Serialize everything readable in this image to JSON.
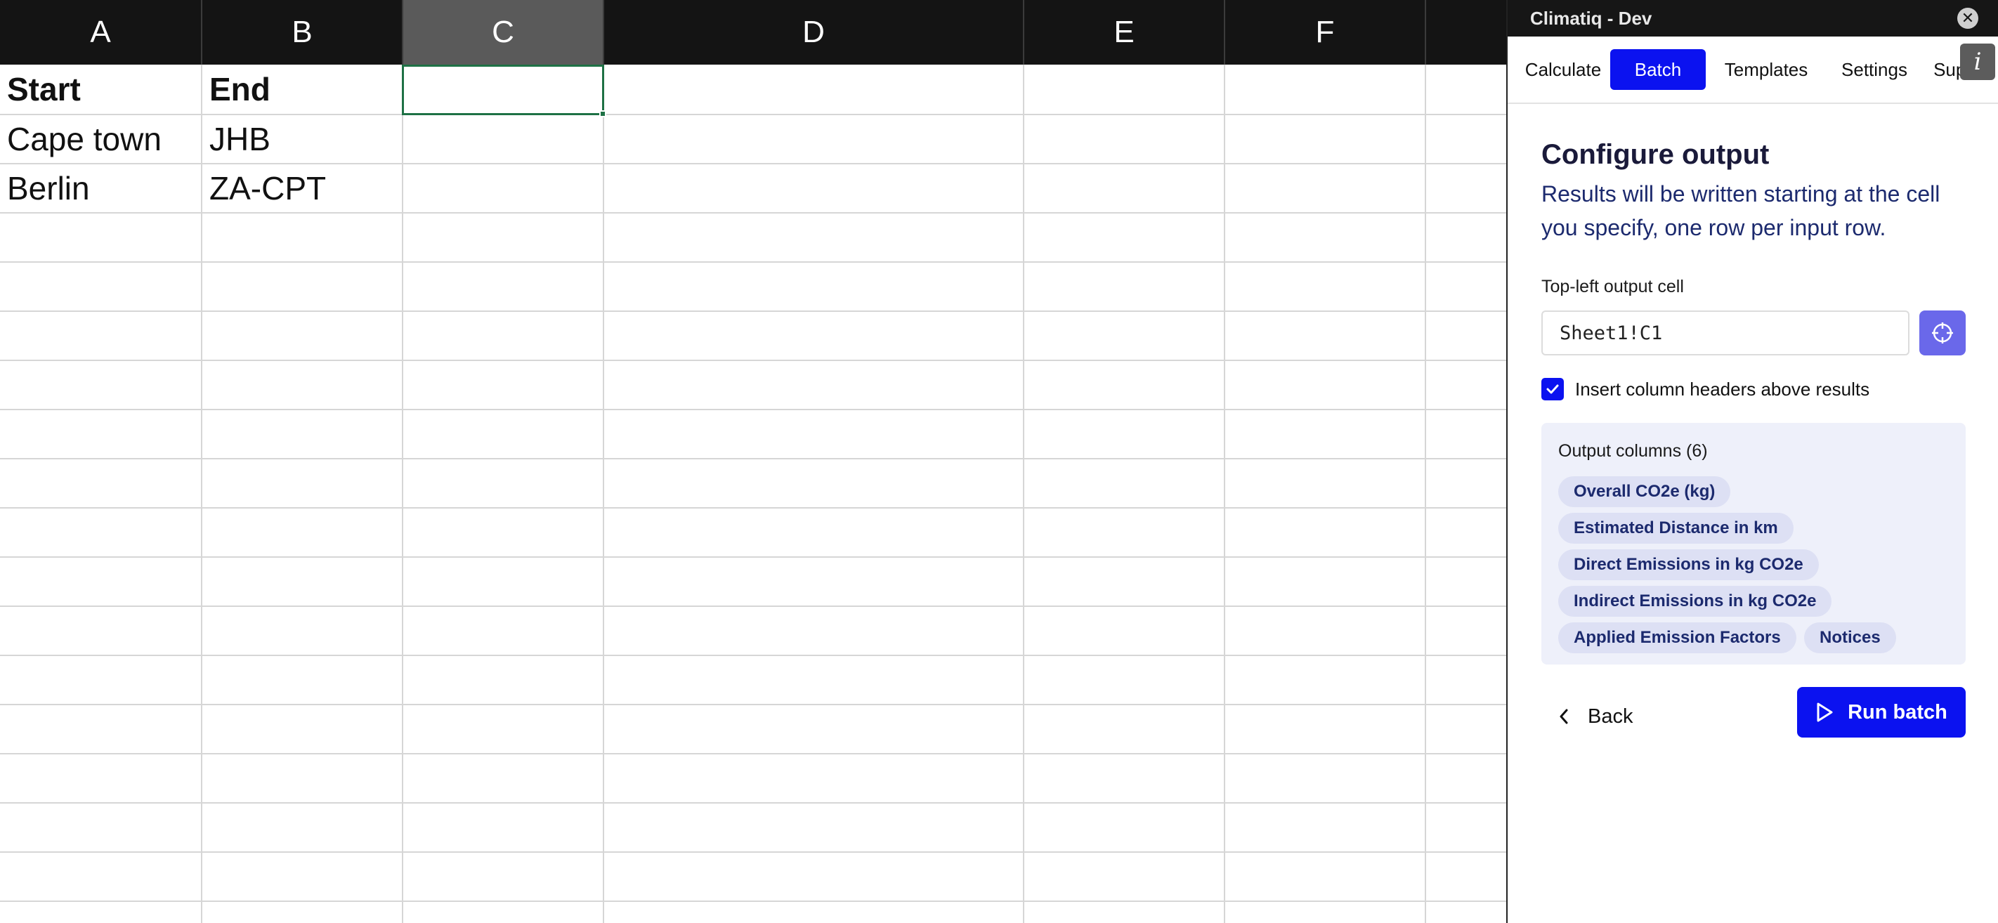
{
  "sheet": {
    "columns": [
      "A",
      "B",
      "C",
      "D",
      "E",
      "F"
    ],
    "selected_column": "C",
    "cells": {
      "A1": "Start",
      "B1": "End",
      "A2": "Cape town",
      "B2": "JHB",
      "A3": "Berlin",
      "B3": "ZA-CPT"
    }
  },
  "pane": {
    "title": "Climatiq - Dev",
    "close_glyph": "✕",
    "info_glyph": "i",
    "tabs": [
      "Calculate",
      "Batch",
      "Templates",
      "Settings",
      "Suppor"
    ],
    "active_tab": "Batch",
    "config": {
      "title": "Configure output",
      "description": "Results will be written starting at the cell you specify, one row per input row.",
      "output_cell_label": "Top-left output cell",
      "output_cell_value": "Sheet1!C1",
      "insert_headers_label": "Insert column headers above results",
      "insert_headers_checked": true,
      "output_columns_label": "Output columns (6)",
      "output_columns": [
        "Overall CO2e (kg)",
        "Estimated Distance in km",
        "Direct Emissions in kg CO2e",
        "Indirect Emissions in kg CO2e",
        "Applied Emission Factors",
        "Notices"
      ],
      "back_label": "Back",
      "run_label": "Run batch"
    }
  },
  "colors": {
    "accent": "#0b12f0",
    "pick_button": "#6a68ea",
    "chip_bg": "#dde0f4",
    "chip_text": "#1c2a6e",
    "active_cell_border": "#1e7145"
  },
  "icons": {
    "close": "close-icon",
    "info": "info-icon",
    "pick_cell": "crosshair-icon",
    "checkbox": "checkmark-icon",
    "back": "chevron-left-icon",
    "run": "play-icon"
  }
}
